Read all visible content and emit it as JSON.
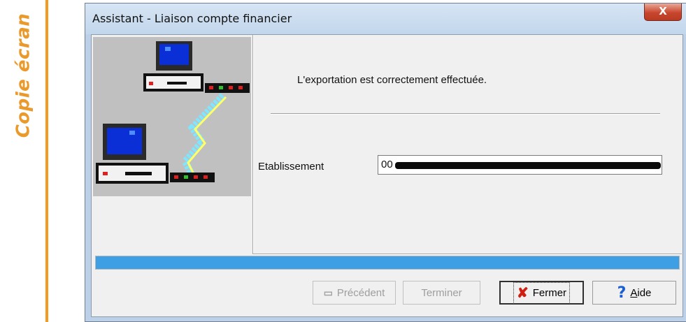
{
  "side_label": "Copie écran",
  "window": {
    "title": "Assistant - Liaison compte financier",
    "close_glyph": "X"
  },
  "content": {
    "message": "L'exportation est correctement effectuée.",
    "etablissement_label": "Etablissement",
    "etablissement_value": "00"
  },
  "progress": {
    "value_percent": 100
  },
  "buttons": {
    "previous": {
      "label": "Précédent",
      "icon": "page-icon",
      "enabled": false
    },
    "finish": {
      "label": "Terminer",
      "enabled": false
    },
    "close": {
      "label": "Fermer",
      "icon": "red-x-icon",
      "enabled": true
    },
    "help": {
      "label_rest": "ide",
      "mnemonic": "A",
      "icon": "question-mark-icon",
      "enabled": true
    }
  },
  "colors": {
    "accent_orange": "#f29a22",
    "progress_blue": "#3f9fe5",
    "close_button_red": "#c9462e"
  },
  "illustration": "two-computers-linked-by-cable"
}
